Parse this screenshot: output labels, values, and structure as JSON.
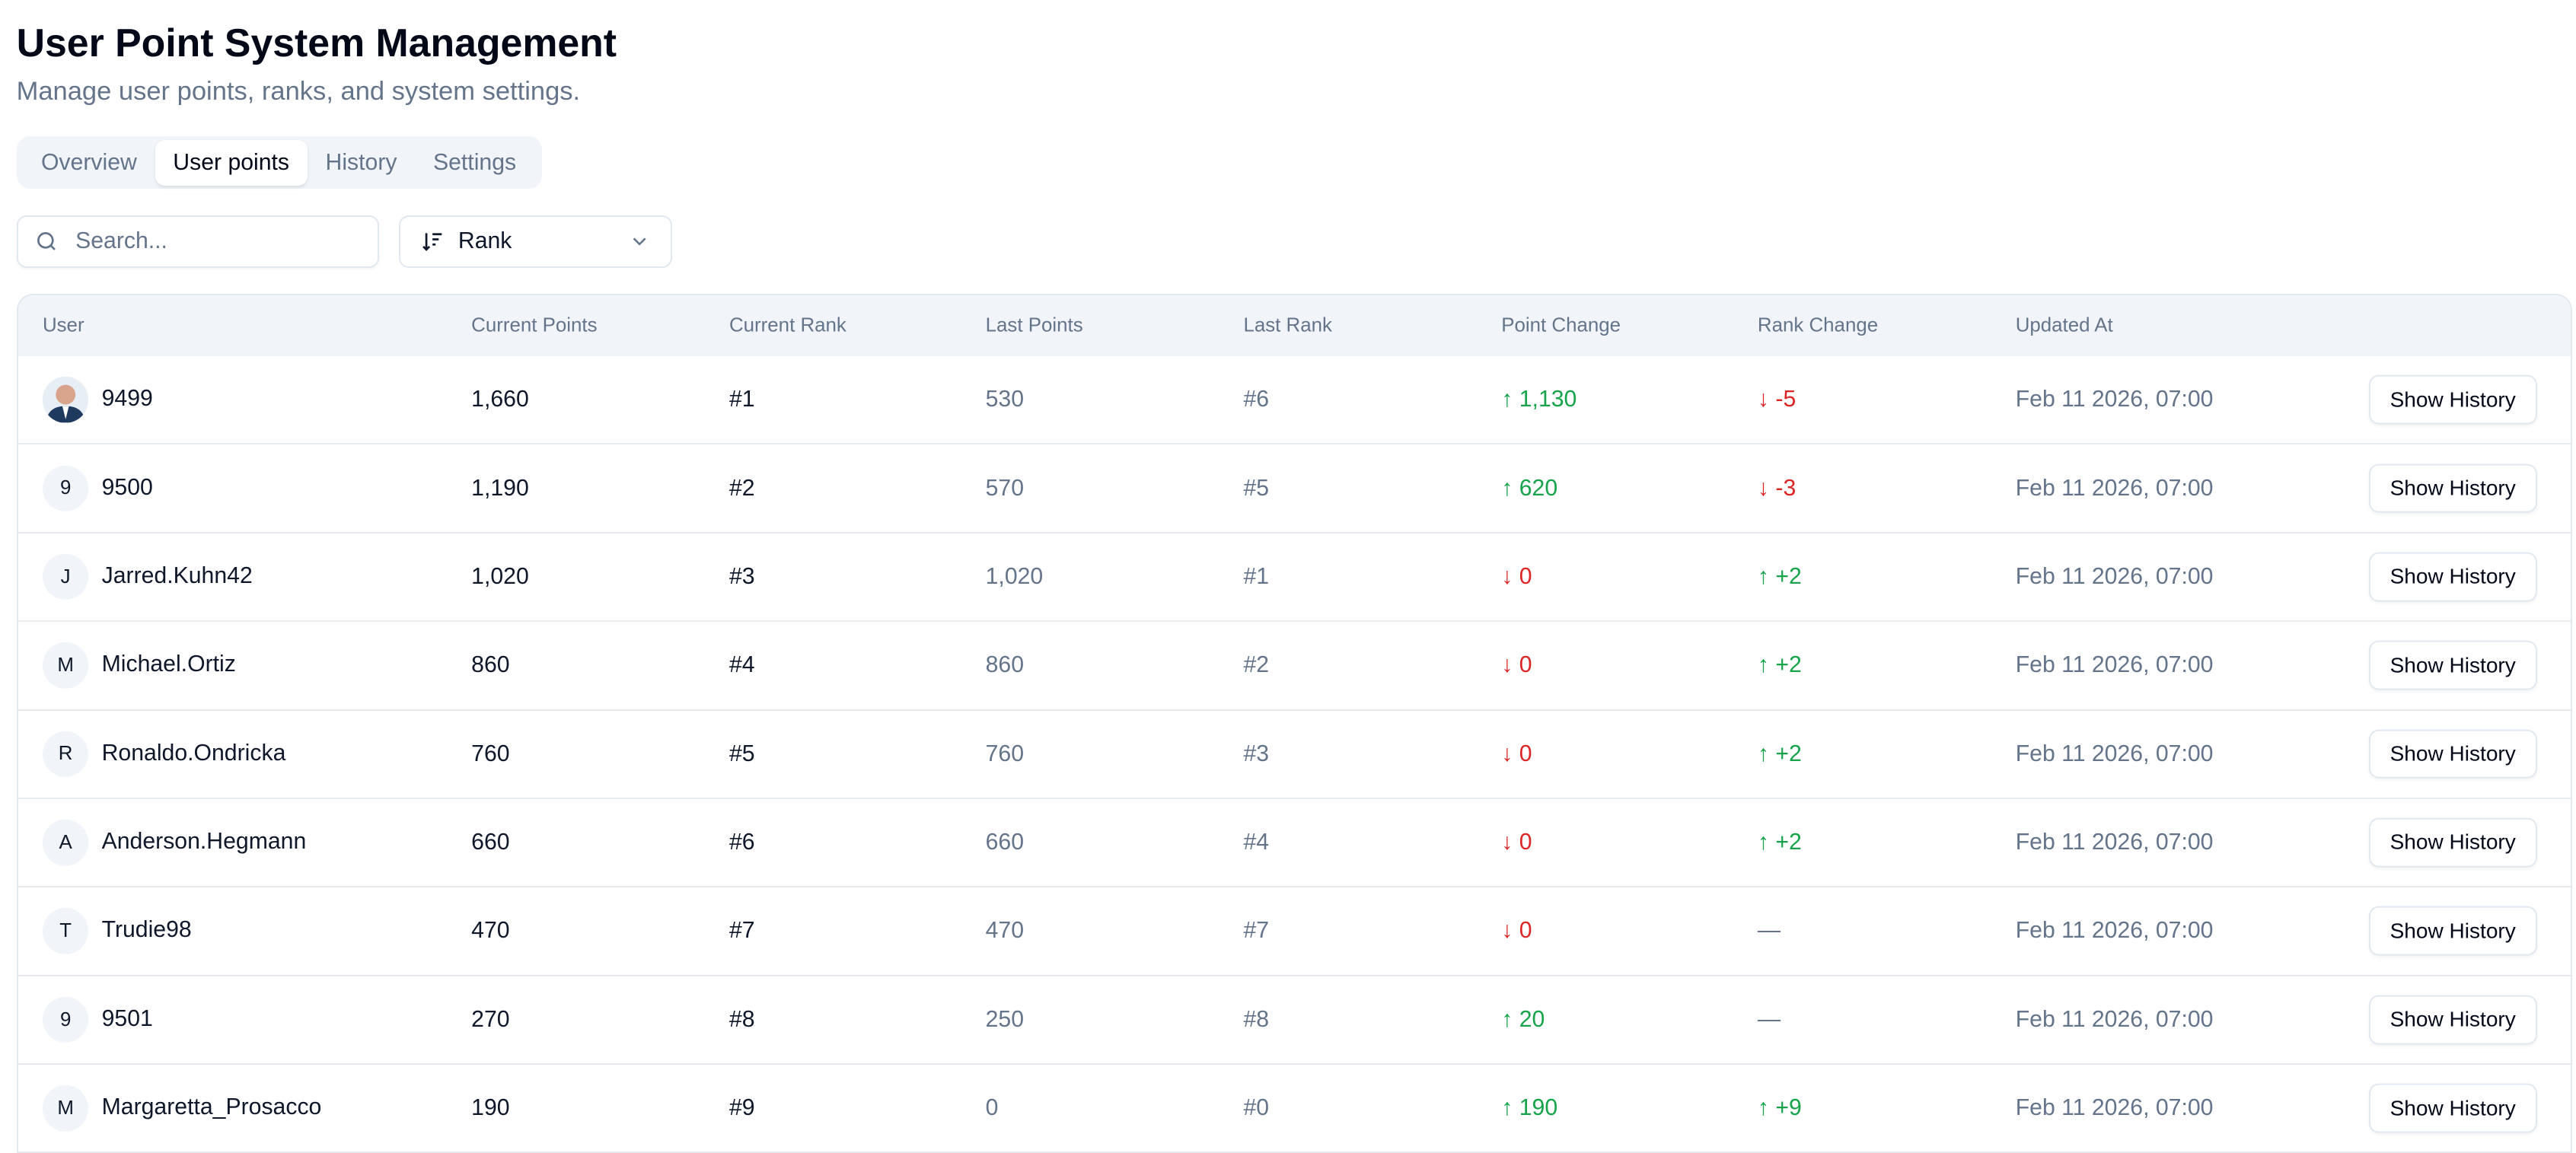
{
  "header": {
    "title": "User Point System Management",
    "subtitle": "Manage user points, ranks, and system settings."
  },
  "tabs": [
    {
      "label": "Overview"
    },
    {
      "label": "User points",
      "active": true
    },
    {
      "label": "History"
    },
    {
      "label": "Settings"
    }
  ],
  "search": {
    "placeholder": "Search...",
    "value": ""
  },
  "sort": {
    "selected": "Rank"
  },
  "table": {
    "columns": [
      "User",
      "Current Points",
      "Current Rank",
      "Last Points",
      "Last Rank",
      "Point Change",
      "Rank Change",
      "Updated At"
    ],
    "button_label": "Show History",
    "rows": [
      {
        "initial": "",
        "photo": true,
        "user": "9499",
        "current_points": "1,660",
        "current_rank": "#1",
        "last_points": "530",
        "last_rank": "#6",
        "point_change": "1,130",
        "point_dir": "up",
        "rank_change": "-5",
        "rank_dir": "down",
        "updated": "Feb 11 2026, 07:00"
      },
      {
        "initial": "9",
        "user": "9500",
        "current_points": "1,190",
        "current_rank": "#2",
        "last_points": "570",
        "last_rank": "#5",
        "point_change": "620",
        "point_dir": "up",
        "rank_change": "-3",
        "rank_dir": "down",
        "updated": "Feb 11 2026, 07:00"
      },
      {
        "initial": "J",
        "user": "Jarred.Kuhn42",
        "current_points": "1,020",
        "current_rank": "#3",
        "last_points": "1,020",
        "last_rank": "#1",
        "point_change": "0",
        "point_dir": "down",
        "rank_change": "+2",
        "rank_dir": "up",
        "updated": "Feb 11 2026, 07:00"
      },
      {
        "initial": "M",
        "user": "Michael.Ortiz",
        "current_points": "860",
        "current_rank": "#4",
        "last_points": "860",
        "last_rank": "#2",
        "point_change": "0",
        "point_dir": "down",
        "rank_change": "+2",
        "rank_dir": "up",
        "updated": "Feb 11 2026, 07:00"
      },
      {
        "initial": "R",
        "user": "Ronaldo.Ondricka",
        "current_points": "760",
        "current_rank": "#5",
        "last_points": "760",
        "last_rank": "#3",
        "point_change": "0",
        "point_dir": "down",
        "rank_change": "+2",
        "rank_dir": "up",
        "updated": "Feb 11 2026, 07:00"
      },
      {
        "initial": "A",
        "user": "Anderson.Hegmann",
        "current_points": "660",
        "current_rank": "#6",
        "last_points": "660",
        "last_rank": "#4",
        "point_change": "0",
        "point_dir": "down",
        "rank_change": "+2",
        "rank_dir": "up",
        "updated": "Feb 11 2026, 07:00"
      },
      {
        "initial": "T",
        "user": "Trudie98",
        "current_points": "470",
        "current_rank": "#7",
        "last_points": "470",
        "last_rank": "#7",
        "point_change": "0",
        "point_dir": "down",
        "rank_change": "—",
        "rank_dir": "none",
        "updated": "Feb 11 2026, 07:00"
      },
      {
        "initial": "9",
        "user": "9501",
        "current_points": "270",
        "current_rank": "#8",
        "last_points": "250",
        "last_rank": "#8",
        "point_change": "20",
        "point_dir": "up",
        "rank_change": "—",
        "rank_dir": "none",
        "updated": "Feb 11 2026, 07:00"
      },
      {
        "initial": "M",
        "user": "Margaretta_Prosacco",
        "current_points": "190",
        "current_rank": "#9",
        "last_points": "0",
        "last_rank": "#0",
        "point_change": "190",
        "point_dir": "up",
        "rank_change": "+9",
        "rank_dir": "up",
        "updated": "Feb 11 2026, 07:00"
      }
    ]
  },
  "colors": {
    "up": "#16a34a",
    "down": "#dc2626",
    "muted": "#64748b"
  }
}
